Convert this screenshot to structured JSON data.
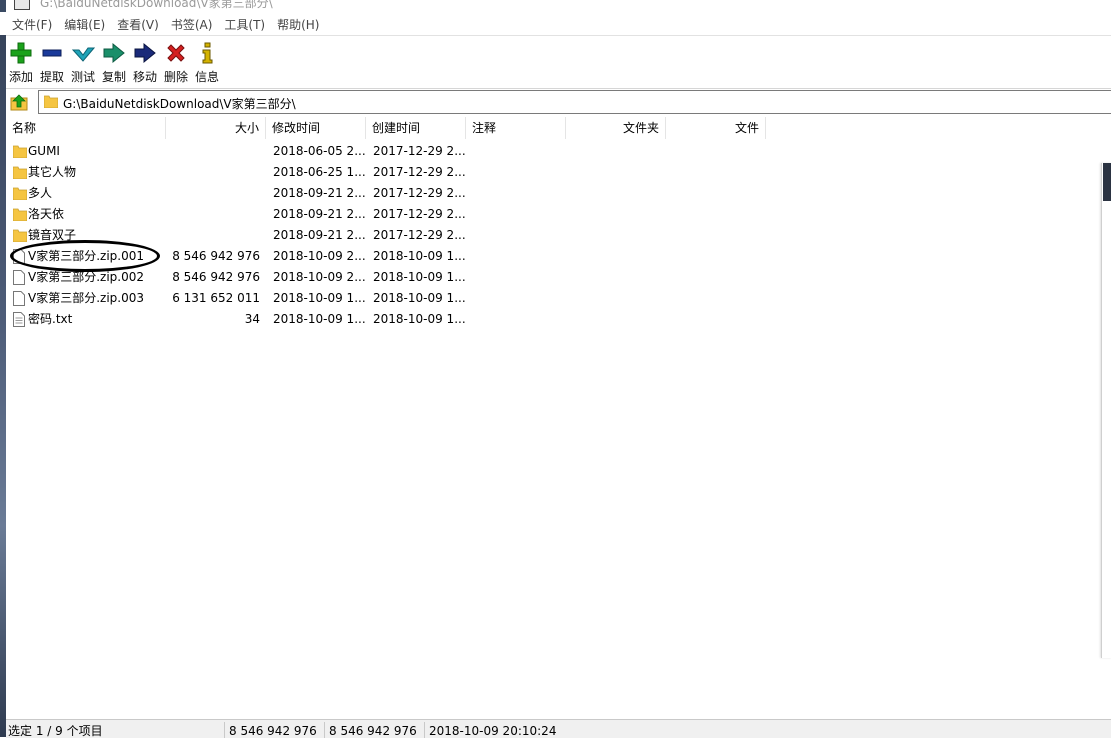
{
  "window": {
    "title": "G:\\BaiduNetdiskDownload\\V家第三部分\\"
  },
  "menu": [
    "文件(F)",
    "编辑(E)",
    "查看(V)",
    "书签(A)",
    "工具(T)",
    "帮助(H)"
  ],
  "toolbar": {
    "add": "添加",
    "extract": "提取",
    "test": "测试",
    "copy": "复制",
    "move": "移动",
    "delete": "删除",
    "info": "信息"
  },
  "address": {
    "path": "G:\\BaiduNetdiskDownload\\V家第三部分\\"
  },
  "columns": {
    "name": "名称",
    "size": "大小",
    "modified": "修改时间",
    "created": "创建时间",
    "comment": "注释",
    "folders": "文件夹",
    "files": "文件"
  },
  "files": [
    {
      "name": "GUMI",
      "size": "",
      "modified": "2018-06-05 2...",
      "created": "2017-12-29 2...",
      "type": "folder"
    },
    {
      "name": "其它人物",
      "size": "",
      "modified": "2018-06-25 1...",
      "created": "2017-12-29 2...",
      "type": "folder"
    },
    {
      "name": "多人",
      "size": "",
      "modified": "2018-09-21 2...",
      "created": "2017-12-29 2...",
      "type": "folder"
    },
    {
      "name": "洛天依",
      "size": "",
      "modified": "2018-09-21 2...",
      "created": "2017-12-29 2...",
      "type": "folder"
    },
    {
      "name": "镜音双子",
      "size": "",
      "modified": "2018-09-21 2...",
      "created": "2017-12-29 2...",
      "type": "folder"
    },
    {
      "name": "V家第三部分.zip.001",
      "size": "8 546 942 976",
      "modified": "2018-10-09 2...",
      "created": "2018-10-09 1...",
      "type": "file"
    },
    {
      "name": "V家第三部分.zip.002",
      "size": "8 546 942 976",
      "modified": "2018-10-09 2...",
      "created": "2018-10-09 1...",
      "type": "file"
    },
    {
      "name": "V家第三部分.zip.003",
      "size": "6 131 652 011",
      "modified": "2018-10-09 1...",
      "created": "2018-10-09 1...",
      "type": "file"
    },
    {
      "name": "密码.txt",
      "size": "34",
      "modified": "2018-10-09 1...",
      "created": "2018-10-09 1...",
      "type": "text"
    }
  ],
  "status": {
    "selection": "选定 1 / 9 个项目",
    "selected_size": "8 546 942 976",
    "total_size": "8 546 942 976",
    "datetime": "2018-10-09 20:10:24"
  },
  "colors": {
    "add_icon": "#1aa21a",
    "extract_icon": "#1a3a9a",
    "test_icon": "#1fa3b8",
    "copy_icon": "#1a8f6a",
    "move_icon": "#1a2a7a",
    "delete_icon": "#d42020",
    "info_icon": "#d4b300",
    "folder_icon": "#f5c542"
  }
}
